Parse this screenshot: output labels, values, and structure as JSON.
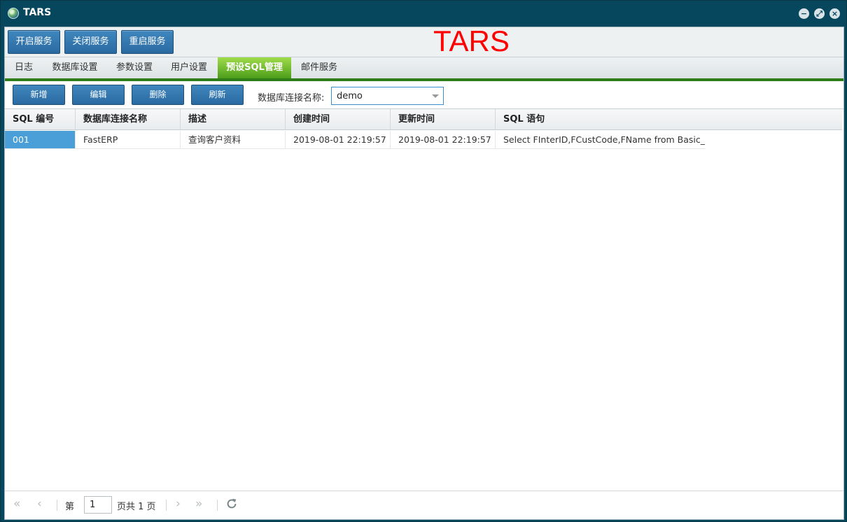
{
  "window": {
    "title": "TARS"
  },
  "header": {
    "buttons": [
      "开启服务",
      "关闭服务",
      "重启服务"
    ],
    "app_title": "TARS"
  },
  "tabs": [
    {
      "label": "日志",
      "active": false
    },
    {
      "label": "数据库设置",
      "active": false
    },
    {
      "label": "参数设置",
      "active": false
    },
    {
      "label": "用户设置",
      "active": false
    },
    {
      "label": "预设SQL管理",
      "active": true
    },
    {
      "label": "邮件服务",
      "active": false
    }
  ],
  "toolbar": {
    "buttons": [
      "新增",
      "编辑",
      "删除",
      "刷新"
    ],
    "connection_label": "数据库连接名称:",
    "connection_value": "demo"
  },
  "table": {
    "columns": [
      "SQL 编号",
      "数据库连接名称",
      "描述",
      "创建时间",
      "更新时间",
      "SQL 语句"
    ],
    "rows": [
      [
        "001",
        "FastERP",
        "查询客户资料",
        "2019-08-01 22:19:57",
        "2019-08-01 22:19:57",
        "Select FInterID,FCustCode,FName from Basic_Cu"
      ]
    ]
  },
  "pager": {
    "page_prefix": "第",
    "page_value": "1",
    "page_suffix": "页共 1 页"
  },
  "colors": {
    "titlebar": "#06475e",
    "button": "#2a6aa1",
    "active_tab": "#4d9d1a",
    "selected_cell": "#4a9fd8",
    "app_title": "#ff0000"
  }
}
